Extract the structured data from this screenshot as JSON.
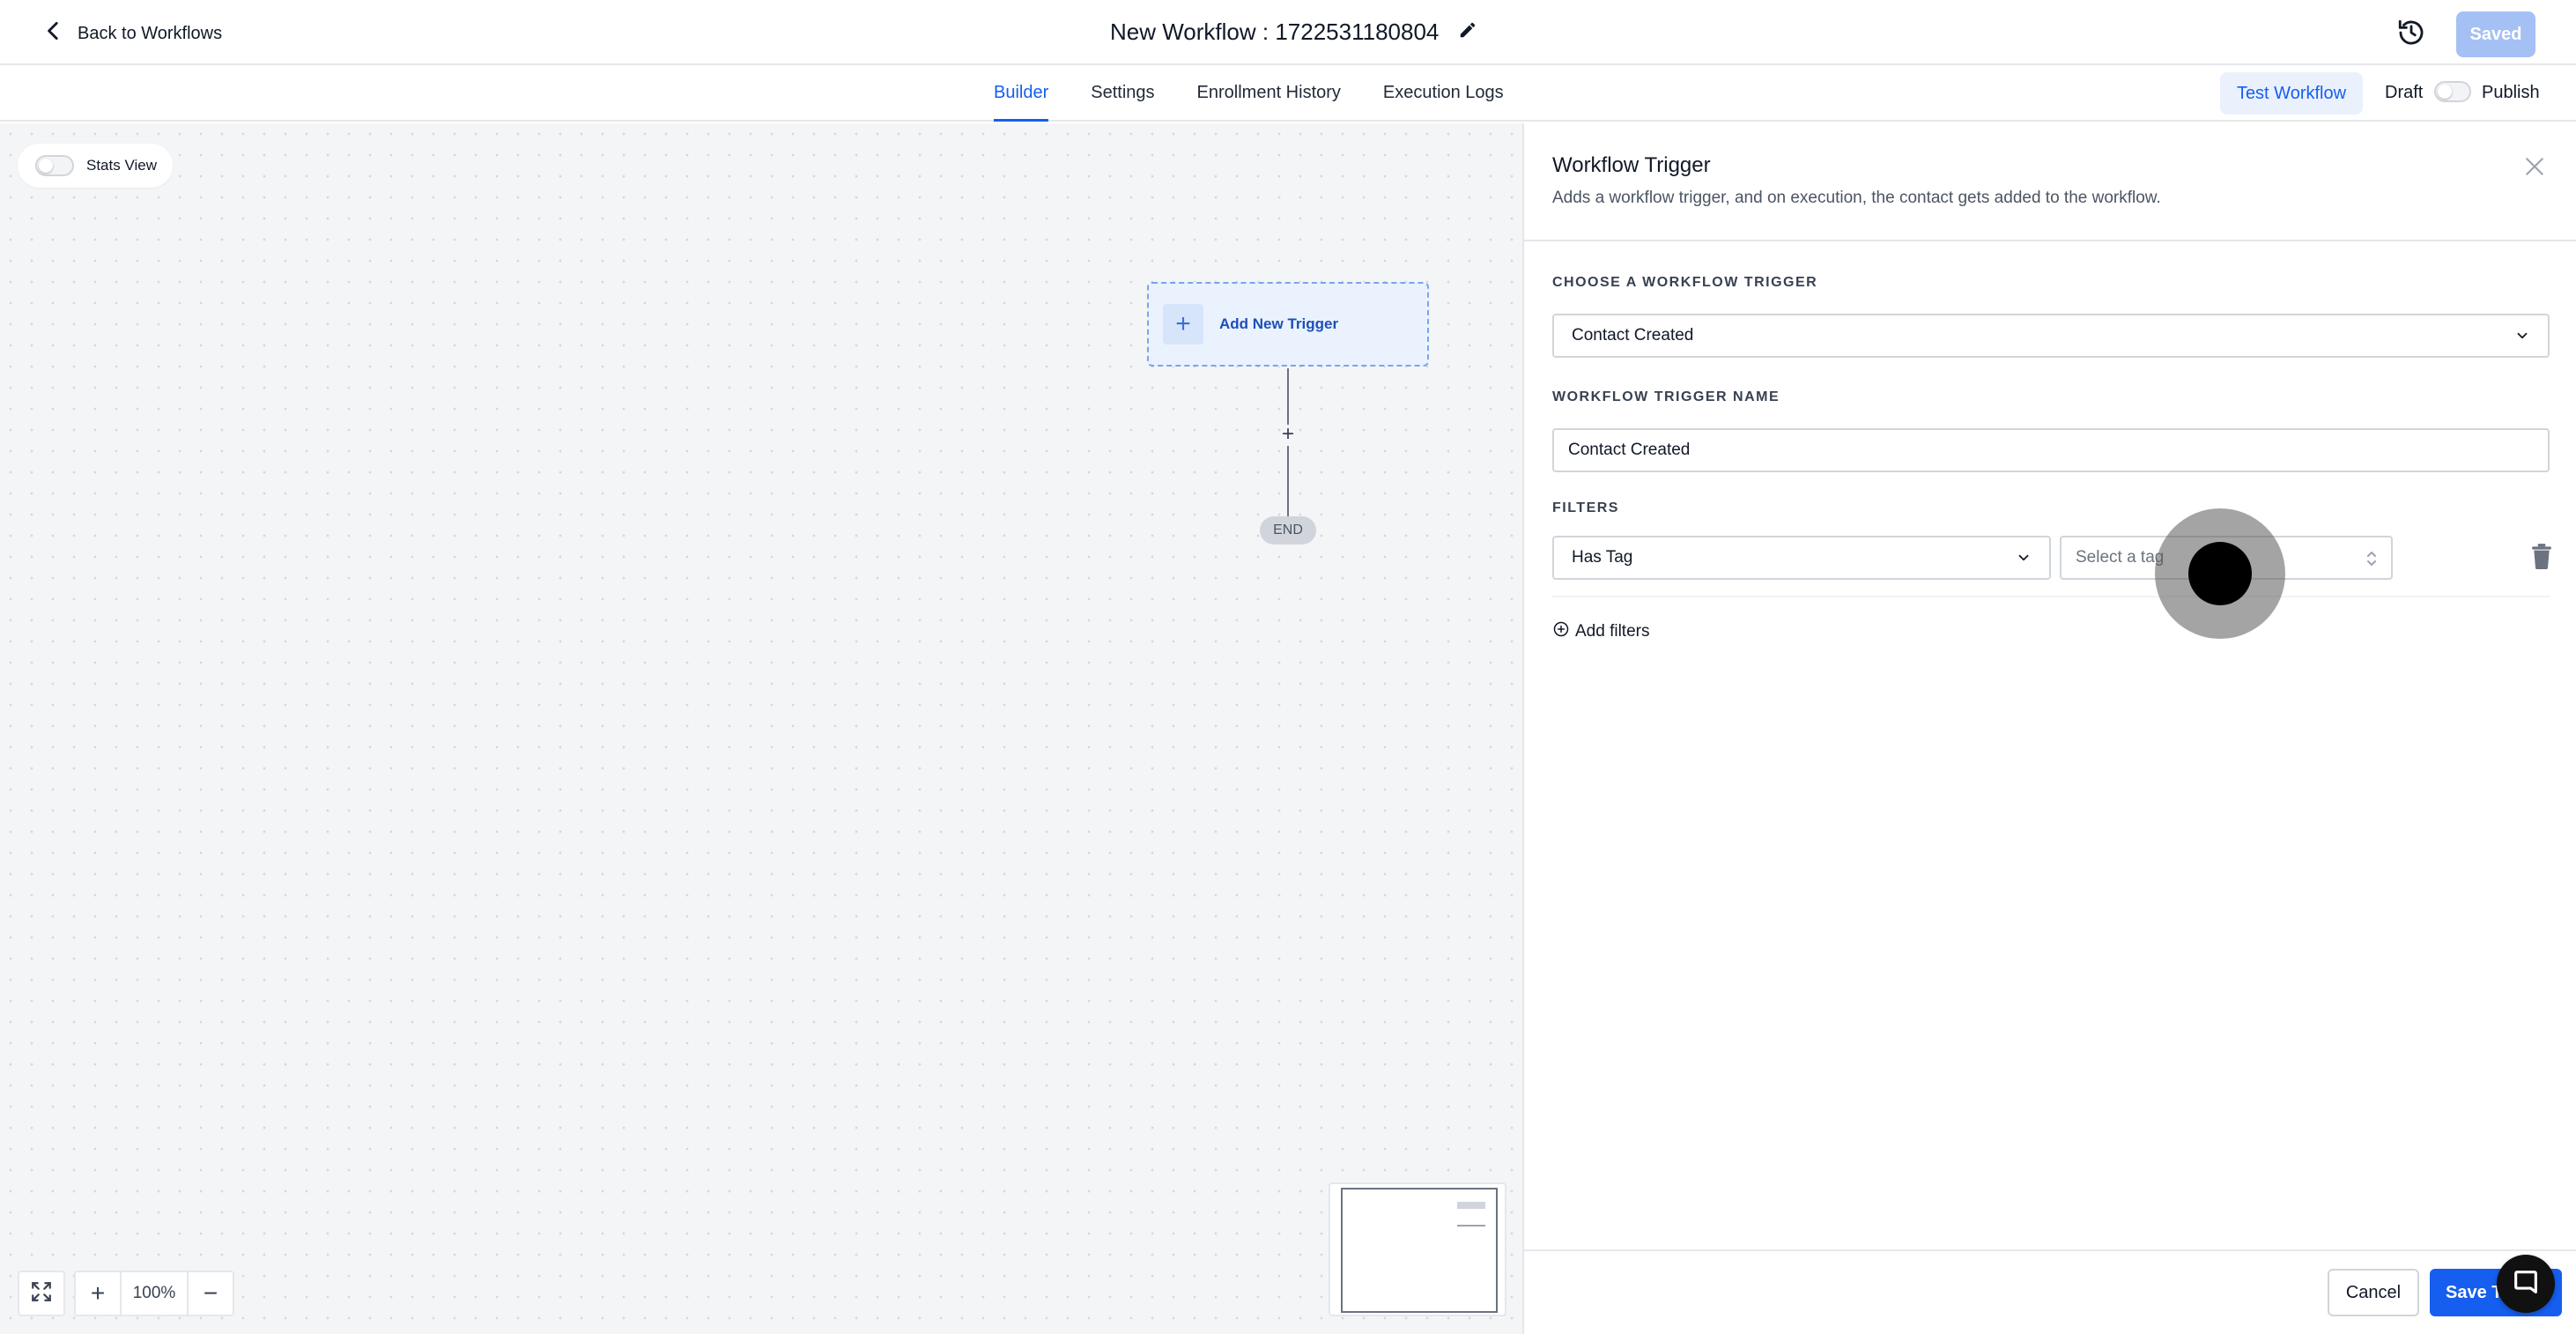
{
  "header": {
    "back_label": "Back to Workflows",
    "workflow_title": "New Workflow : 1722531180804",
    "saved_label": "Saved"
  },
  "tabs": [
    {
      "label": "Builder",
      "active": true
    },
    {
      "label": "Settings",
      "active": false
    },
    {
      "label": "Enrollment History",
      "active": false
    },
    {
      "label": "Execution Logs",
      "active": false
    }
  ],
  "toolbar": {
    "test_label": "Test Workflow",
    "draft_label": "Draft",
    "publish_label": "Publish",
    "publish_on": false
  },
  "canvas": {
    "stats_label": "Stats View",
    "stats_on": false,
    "add_trigger_label": "Add New Trigger",
    "end_label": "END",
    "zoom_level": "100%"
  },
  "panel": {
    "title": "Workflow Trigger",
    "subtitle": "Adds a workflow trigger, and on execution, the contact gets added to the workflow.",
    "choose_label": "CHOOSE A WORKFLOW TRIGGER",
    "trigger_value": "Contact Created",
    "name_label": "WORKFLOW TRIGGER NAME",
    "name_value": "Contact Created",
    "filters_label": "FILTERS",
    "filter_type": "Has Tag",
    "tag_placeholder": "Select a tag",
    "add_filters_label": "Add filters",
    "cancel_label": "Cancel",
    "save_label": "Save Trigger"
  },
  "colors": {
    "accent": "#155eef",
    "saved_disabled": "#a5c0f5",
    "canvas_bg": "#f4f5f7"
  },
  "icons": [
    "chevron-left-icon",
    "pencil-icon",
    "history-icon",
    "close-icon",
    "chevron-down-icon",
    "updown-icon",
    "trash-icon",
    "plus-circle-icon",
    "fit-screen-icon",
    "chat-icon"
  ]
}
